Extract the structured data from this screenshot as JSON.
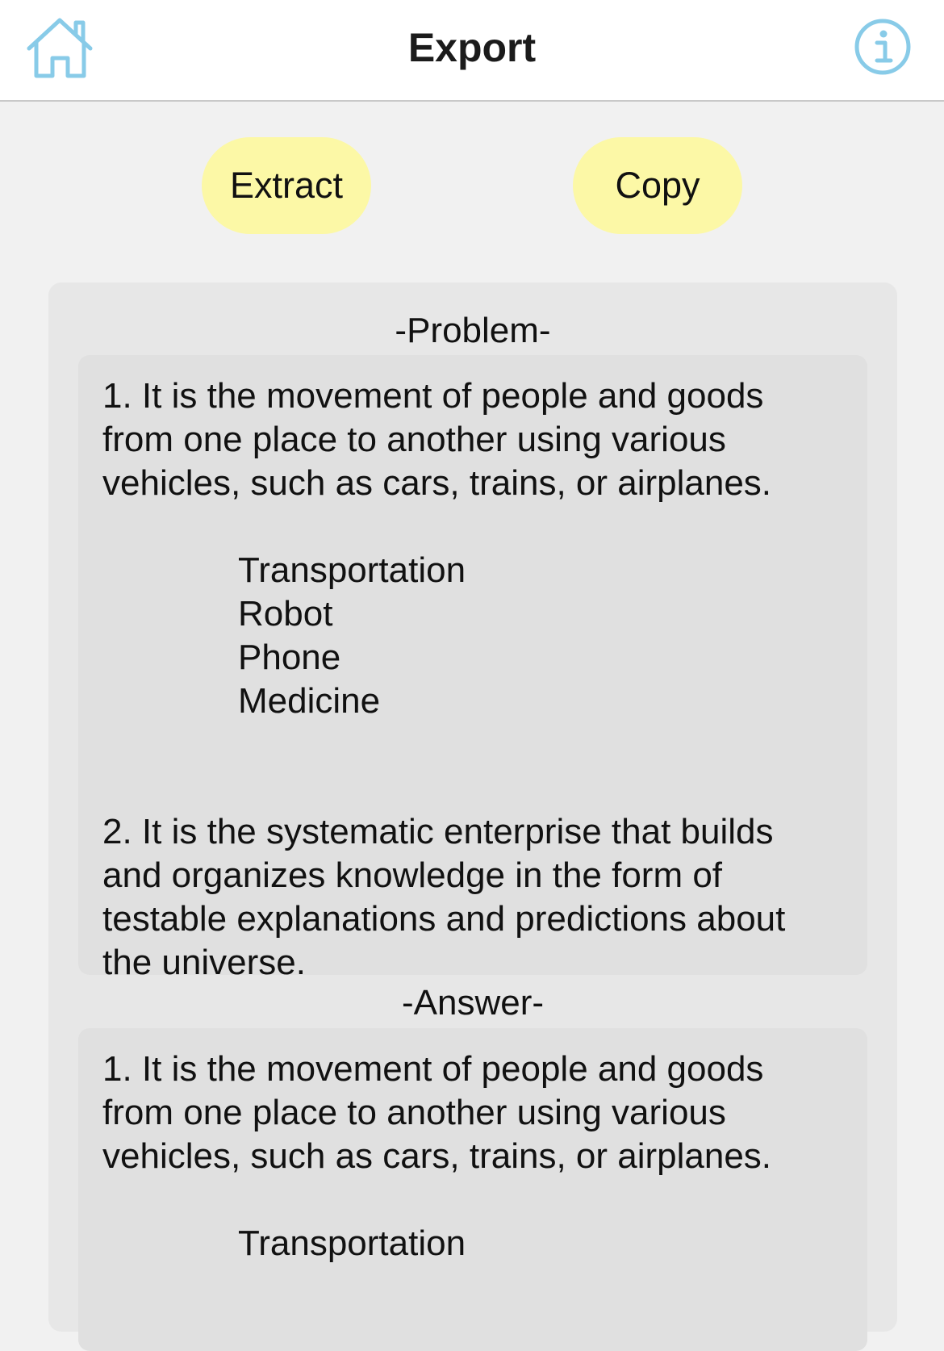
{
  "header": {
    "title": "Export",
    "home_icon": "home-icon",
    "info_icon": "info-icon",
    "accent_color": "#88cbe8"
  },
  "actions": {
    "extract_label": "Extract",
    "copy_label": "Copy",
    "button_color": "#fcf8a6"
  },
  "problem": {
    "label": "-Problem-",
    "q1": {
      "lines": [
        "1. It is the movement of people and goods",
        "from one place to another using various",
        "vehicles, such as cars, trains, or airplanes."
      ],
      "choices": [
        "Transportation",
        "Robot",
        "Phone",
        "Medicine"
      ]
    },
    "q2": {
      "lines": [
        "2. It is the systematic enterprise that builds",
        "and organizes knowledge in the form of",
        "testable explanations and predictions about",
        "the universe."
      ]
    }
  },
  "answer": {
    "label": "-Answer-",
    "q1": {
      "lines": [
        "1. It is the movement of people and goods",
        "from one place to another using various",
        "vehicles, such as cars, trains, or airplanes."
      ],
      "answer": "Transportation"
    }
  }
}
